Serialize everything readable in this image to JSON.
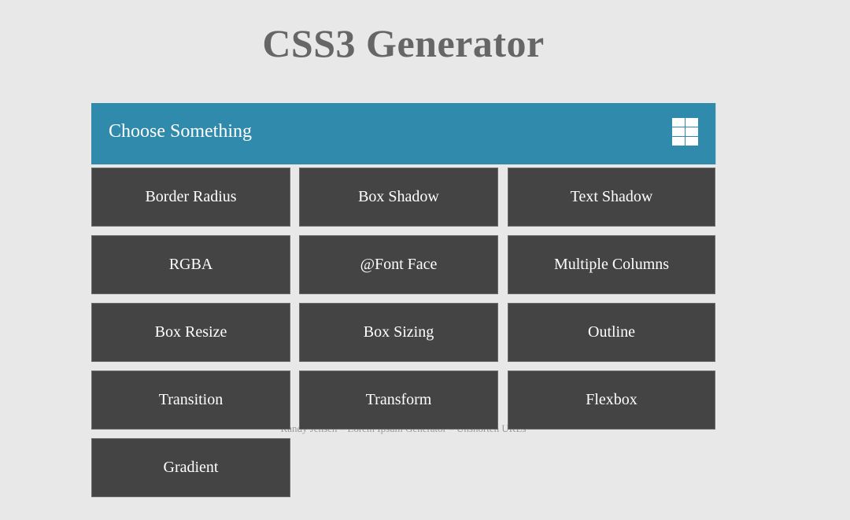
{
  "page": {
    "title": "CSS3 Generator"
  },
  "panel": {
    "header_label": "Choose Something",
    "menu_icon": "grid-menu-icon"
  },
  "tiles": [
    {
      "label": "Border Radius"
    },
    {
      "label": "Box Shadow"
    },
    {
      "label": "Text Shadow"
    },
    {
      "label": "RGBA"
    },
    {
      "label": "@Font Face"
    },
    {
      "label": "Multiple Columns"
    },
    {
      "label": "Box Resize"
    },
    {
      "label": "Box Sizing"
    },
    {
      "label": "Outline"
    },
    {
      "label": "Transition"
    },
    {
      "label": "Transform"
    },
    {
      "label": "Flexbox"
    },
    {
      "label": "Gradient"
    }
  ],
  "footer": {
    "text": "Randy Jensen – Lorem Ipsum Generator – Unshorten URLs"
  },
  "colors": {
    "accent": "#2f8aab",
    "tile_bg": "#444444",
    "page_bg": "#e8e8e8",
    "title": "#666666"
  }
}
